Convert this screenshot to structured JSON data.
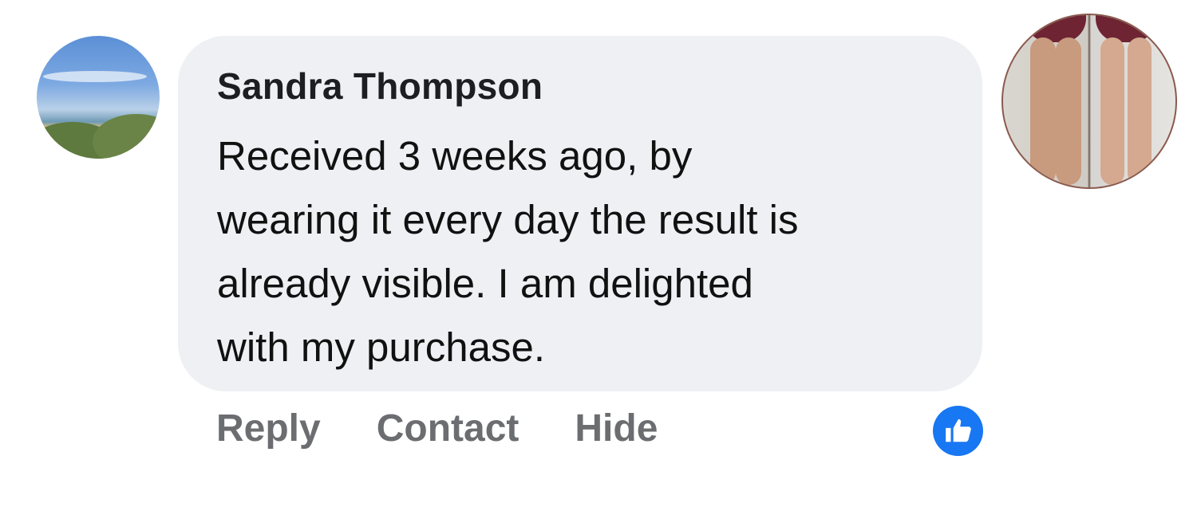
{
  "comment": {
    "author": "Sandra Thompson",
    "lines": [
      "Received 3 weeks ago, by",
      "wearing it every day the result is",
      "already visible. I am delighted",
      "with my purchase."
    ]
  },
  "actions": {
    "reply": "Reply",
    "contact": "Contact",
    "hide": "Hide"
  },
  "icons": {
    "avatar": "profile-photo-beach",
    "like": "thumbs-up-icon",
    "attached_photo": "before-after-legs-photo"
  },
  "colors": {
    "bubble": "#eef0f4",
    "action_text": "#6b6d71",
    "like_badge": "#1877f2"
  }
}
